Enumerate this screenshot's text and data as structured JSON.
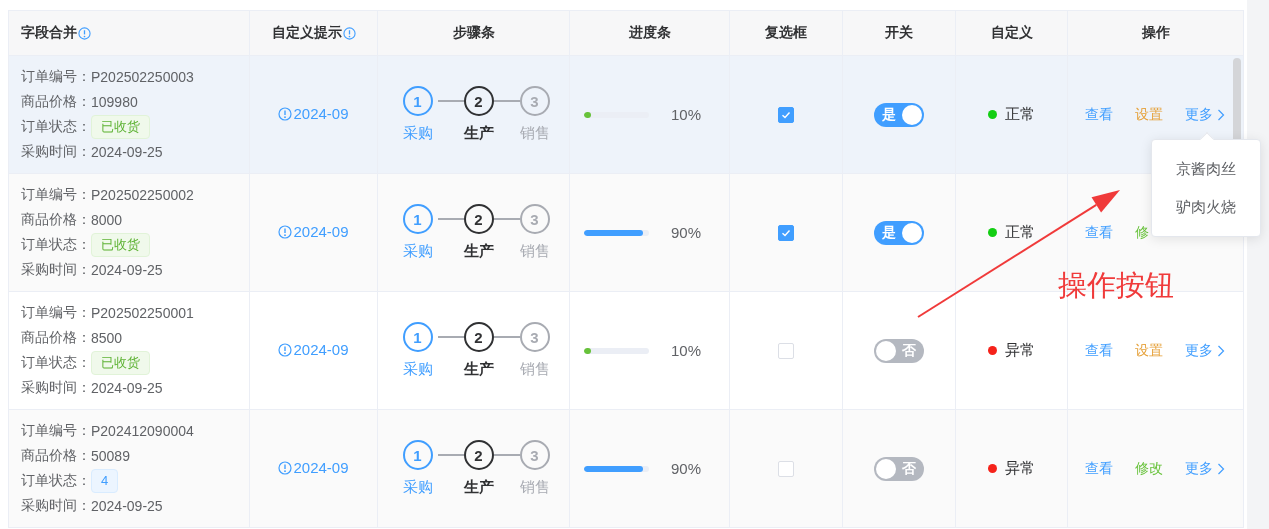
{
  "columns": [
    {
      "label": "字段合并",
      "info": true
    },
    {
      "label": "自定义提示",
      "info": true
    },
    {
      "label": "步骤条",
      "info": false
    },
    {
      "label": "进度条",
      "info": false
    },
    {
      "label": "复选框",
      "info": false
    },
    {
      "label": "开关",
      "info": false
    },
    {
      "label": "自定义",
      "info": false
    },
    {
      "label": "操作",
      "info": false
    }
  ],
  "rows": [
    {
      "hovered": true,
      "order": [
        {
          "kind": "text",
          "label": "订单编号：",
          "value": "P202502250003"
        },
        {
          "kind": "text",
          "label": "商品价格：",
          "value": "109980"
        },
        {
          "kind": "tag",
          "label": "订单状态：",
          "tag": {
            "kind": "success",
            "text": "已收货"
          }
        },
        {
          "kind": "text",
          "label": "采购时间：",
          "value": "2024-09-25"
        }
      ],
      "tip": "2024-09",
      "steps": [
        {
          "number": "1",
          "label": "采购",
          "kind": "finish"
        },
        {
          "number": "2",
          "label": "生产",
          "kind": "process"
        },
        {
          "number": "3",
          "label": "销售",
          "kind": "wait"
        }
      ],
      "progress": {
        "level": 0.1,
        "text": "10%",
        "color": "#67c23a"
      },
      "checked": true,
      "switch": {
        "on": true,
        "label": "是"
      },
      "status": {
        "color": "#13ce13",
        "text": "正常"
      },
      "actions": [
        {
          "kind": "primary",
          "label": "查看"
        },
        {
          "kind": "warning",
          "label": "设置"
        },
        {
          "kind": "more",
          "label": "更多"
        }
      ]
    },
    {
      "hovered": false,
      "order": [
        {
          "kind": "text",
          "label": "订单编号：",
          "value": "P202502250002"
        },
        {
          "kind": "text",
          "label": "商品价格：",
          "value": "8000"
        },
        {
          "kind": "tag",
          "label": "订单状态：",
          "tag": {
            "kind": "success",
            "text": "已收货"
          }
        },
        {
          "kind": "text",
          "label": "采购时间：",
          "value": "2024-09-25"
        }
      ],
      "tip": "2024-09",
      "steps": [
        {
          "number": "1",
          "label": "采购",
          "kind": "finish"
        },
        {
          "number": "2",
          "label": "生产",
          "kind": "process"
        },
        {
          "number": "3",
          "label": "销售",
          "kind": "wait"
        }
      ],
      "progress": {
        "level": 0.9,
        "text": "90%",
        "color": "#409eff"
      },
      "checked": true,
      "switch": {
        "on": true,
        "label": "是"
      },
      "status": {
        "color": "#13ce13",
        "text": "正常"
      },
      "actions": [
        {
          "kind": "primary",
          "label": "查看"
        },
        {
          "kind": "success",
          "label": "修"
        }
      ]
    },
    {
      "hovered": false,
      "order": [
        {
          "kind": "text",
          "label": "订单编号：",
          "value": "P202502250001"
        },
        {
          "kind": "text",
          "label": "商品价格：",
          "value": "8500"
        },
        {
          "kind": "tag",
          "label": "订单状态：",
          "tag": {
            "kind": "success",
            "text": "已收货"
          }
        },
        {
          "kind": "text",
          "label": "采购时间：",
          "value": "2024-09-25"
        }
      ],
      "tip": "2024-09",
      "steps": [
        {
          "number": "1",
          "label": "采购",
          "kind": "finish"
        },
        {
          "number": "2",
          "label": "生产",
          "kind": "process"
        },
        {
          "number": "3",
          "label": "销售",
          "kind": "wait"
        }
      ],
      "progress": {
        "level": 0.1,
        "text": "10%",
        "color": "#67c23a"
      },
      "checked": false,
      "switch": {
        "on": false,
        "label": "否"
      },
      "status": {
        "color": "#f5221a",
        "text": "异常"
      },
      "actions": [
        {
          "kind": "primary",
          "label": "查看"
        },
        {
          "kind": "warning",
          "label": "设置"
        },
        {
          "kind": "more",
          "label": "更多"
        }
      ]
    },
    {
      "hovered": false,
      "order": [
        {
          "kind": "text",
          "label": "订单编号：",
          "value": "P202412090004"
        },
        {
          "kind": "text",
          "label": "商品价格：",
          "value": "50089"
        },
        {
          "kind": "tag",
          "label": "订单状态：",
          "tag": {
            "kind": "primary",
            "text": "4"
          }
        },
        {
          "kind": "text",
          "label": "采购时间：",
          "value": "2024-09-25"
        }
      ],
      "tip": "2024-09",
      "steps": [
        {
          "number": "1",
          "label": "采购",
          "kind": "finish"
        },
        {
          "number": "2",
          "label": "生产",
          "kind": "process"
        },
        {
          "number": "3",
          "label": "销售",
          "kind": "wait"
        }
      ],
      "progress": {
        "level": 0.9,
        "text": "90%",
        "color": "#409eff"
      },
      "checked": false,
      "switch": {
        "on": false,
        "label": "否"
      },
      "status": {
        "color": "#f5221a",
        "text": "异常"
      },
      "actions": [
        {
          "kind": "primary",
          "label": "查看"
        },
        {
          "kind": "success",
          "label": "修改"
        },
        {
          "kind": "more",
          "label": "更多"
        }
      ]
    }
  ],
  "dropdown": {
    "items": [
      "京酱肉丝",
      "驴肉火烧"
    ]
  },
  "annotation": {
    "text": "操作按钮"
  }
}
